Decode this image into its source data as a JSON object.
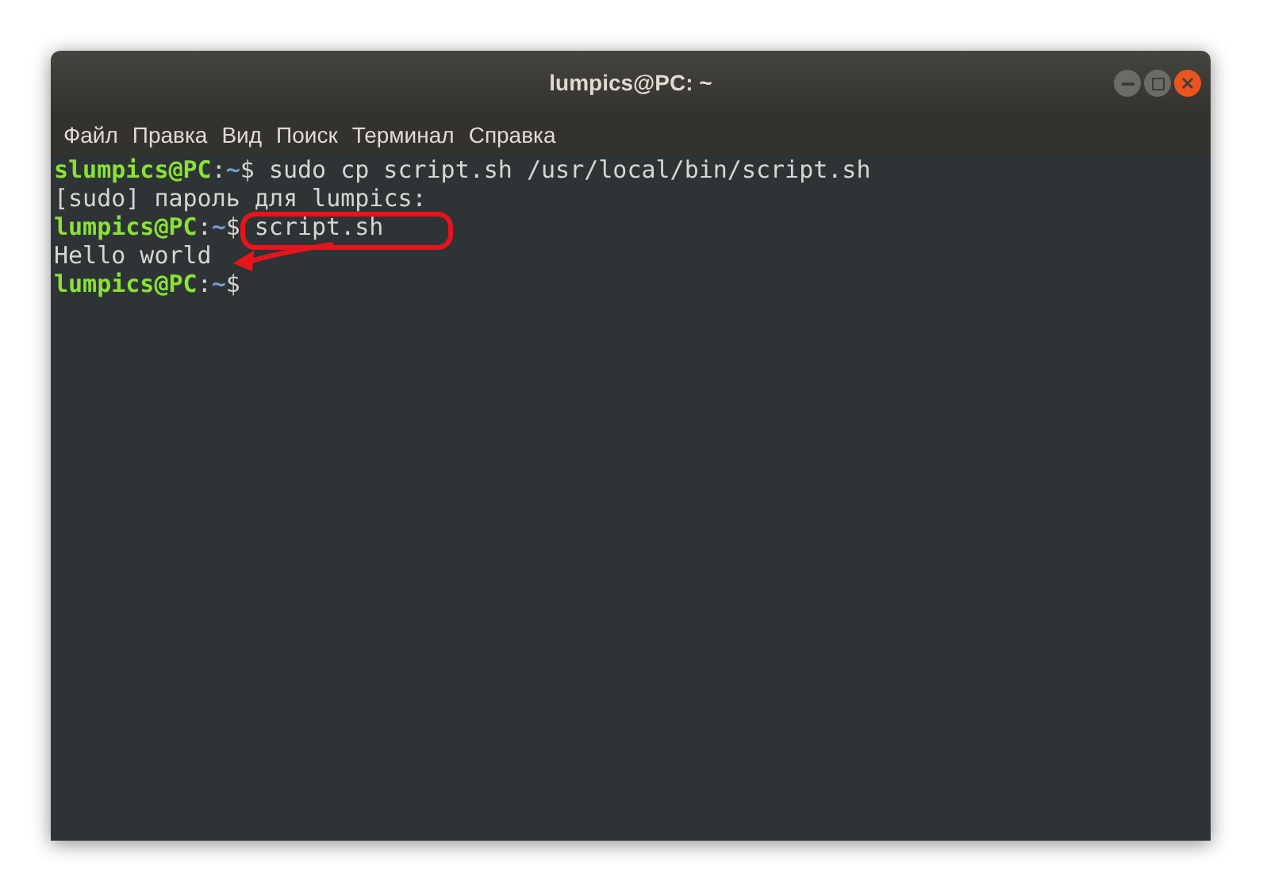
{
  "window": {
    "title": "lumpics@PC: ~"
  },
  "menu": [
    {
      "label": "Файл"
    },
    {
      "label": "Правка"
    },
    {
      "label": "Вид"
    },
    {
      "label": "Поиск"
    },
    {
      "label": "Терминал"
    },
    {
      "label": "Справка"
    }
  ],
  "terminal": {
    "lines": [
      {
        "kind": "prompt",
        "user": "slumpics@PC",
        "separator": ":",
        "path": "~",
        "symbol": "$",
        "command": "sudo cp script.sh /usr/local/bin/script.sh"
      },
      {
        "kind": "output",
        "text": "[sudo] пароль для lumpics:"
      },
      {
        "kind": "prompt",
        "user": "lumpics@PC",
        "separator": ":",
        "path": "~",
        "symbol": "$",
        "command": "script.sh"
      },
      {
        "kind": "output",
        "text": "Hello world"
      },
      {
        "kind": "prompt",
        "user": "lumpics@PC",
        "separator": ":",
        "path": "~",
        "symbol": "$"
      }
    ]
  }
}
